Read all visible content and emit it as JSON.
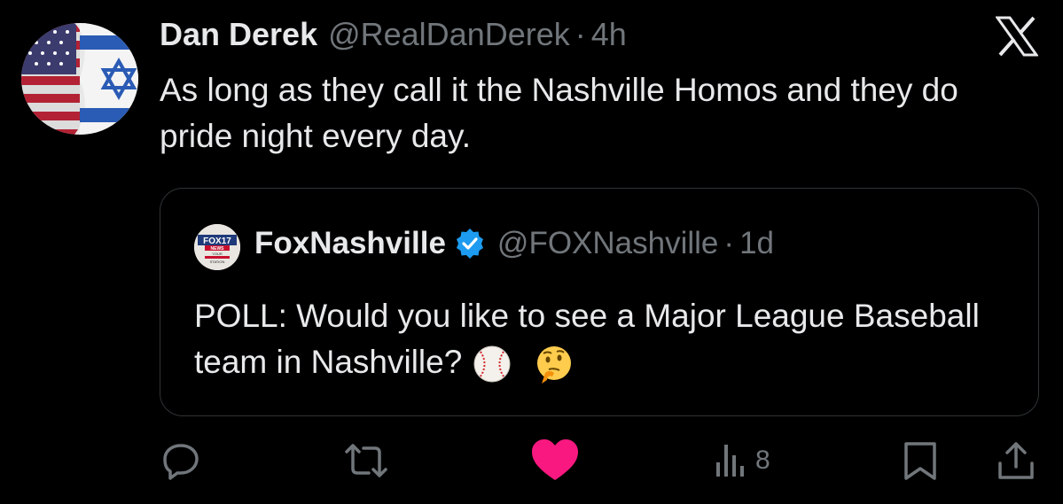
{
  "tweet": {
    "author_name": "Dan Derek",
    "author_handle": "@RealDanDerek",
    "separator": "·",
    "time": "4h",
    "text": "As long as they call it the Nashville Homos and they do pride night every day."
  },
  "quoted_tweet": {
    "author_name": "FoxNashville",
    "author_handle": "@FOXNashville",
    "separator": "·",
    "time": "1d",
    "text": "POLL: Would you like to see a Major League Baseball team in Nashville?",
    "avatar_logo_text": [
      "FOX17",
      "NEWS",
      "YOUR",
      "STATION"
    ],
    "emojis": [
      "baseball-emoji",
      "thinking-face-emoji"
    ]
  },
  "actions": {
    "views_count": "8",
    "icons": [
      "reply-icon",
      "retweet-icon",
      "like-icon",
      "views-icon",
      "bookmark-icon",
      "share-icon"
    ],
    "like_color": "#f91880"
  },
  "colors": {
    "background": "#000000",
    "primary_text": "#e7e9ea",
    "secondary_text": "#71767b",
    "verified": "#1d9bf0",
    "border": "#2f3336"
  }
}
